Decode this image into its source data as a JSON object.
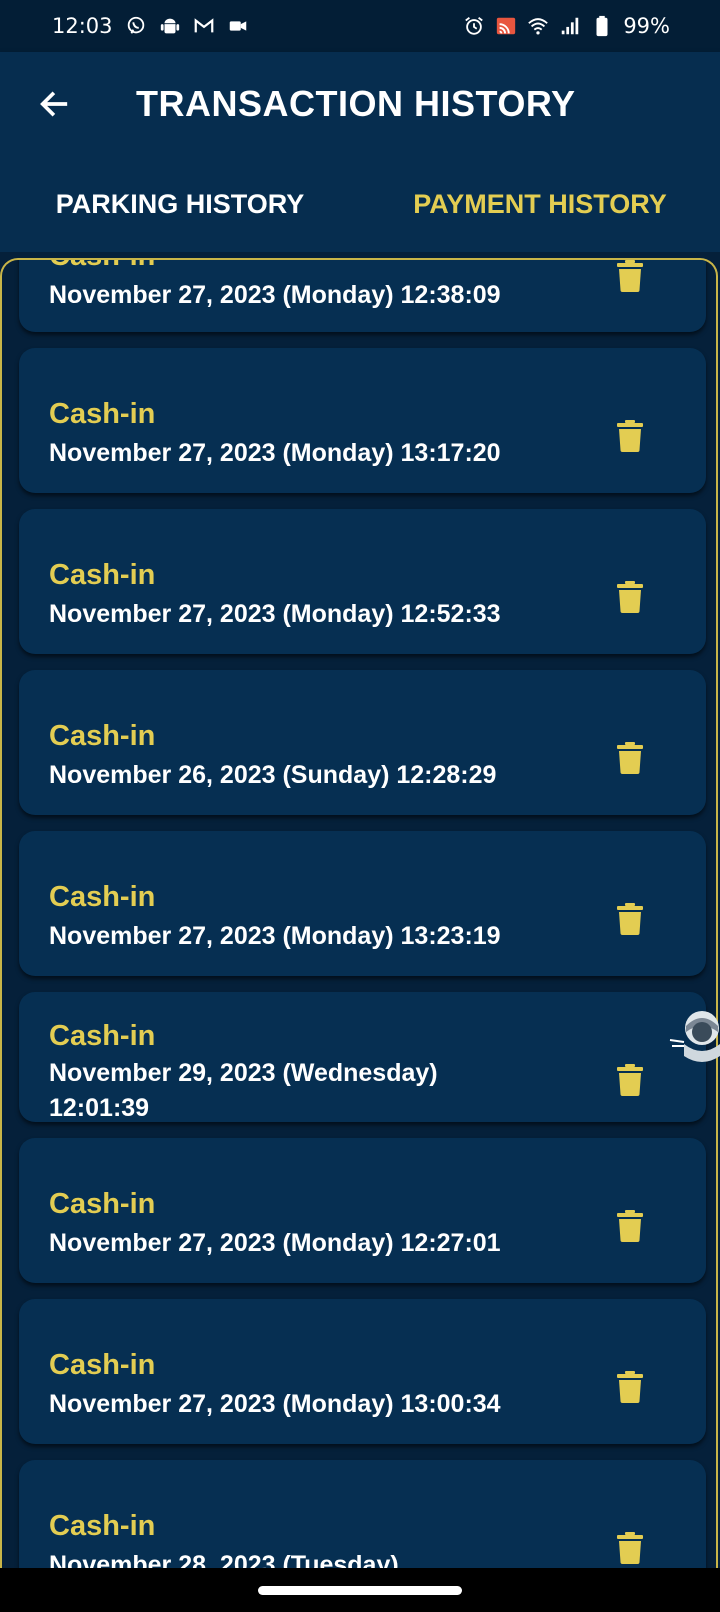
{
  "status_bar": {
    "time": "12:03",
    "battery": "99%",
    "left_icons": [
      "viber-icon",
      "android-icon",
      "gmail-icon",
      "video-icon"
    ],
    "right_icons": [
      "alarm-icon",
      "cast-icon",
      "wifi-icon",
      "signal-icon",
      "battery-icon"
    ]
  },
  "app_bar": {
    "title": "TRANSACTION HISTORY",
    "back_icon": "back-arrow-icon"
  },
  "tabs": [
    {
      "label": "PARKING HISTORY",
      "active": false
    },
    {
      "label": "PAYMENT HISTORY",
      "active": true
    }
  ],
  "colors": {
    "background": "#05203a",
    "card": "#062f52",
    "accent": "#e3cd52",
    "text": "#ffffff"
  },
  "transactions": [
    {
      "type": "Cash-in",
      "date": "November 27, 2023 (Monday) 12:38:09"
    },
    {
      "type": "Cash-in",
      "date": "November 27, 2023 (Monday) 13:17:20"
    },
    {
      "type": "Cash-in",
      "date": "November 27, 2023 (Monday) 12:52:33"
    },
    {
      "type": "Cash-in",
      "date": "November 26, 2023 (Sunday) 12:28:29"
    },
    {
      "type": "Cash-in",
      "date": "November 27, 2023 (Monday) 13:23:19"
    },
    {
      "type": "Cash-in",
      "date": "November 29, 2023 (Wednesday) 12:01:39"
    },
    {
      "type": "Cash-in",
      "date": "November 27, 2023 (Monday) 12:27:01"
    },
    {
      "type": "Cash-in",
      "date": "November 27, 2023 (Monday) 13:00:34"
    },
    {
      "type": "Cash-in",
      "date": "November 28, 2023 (Tuesday)"
    }
  ]
}
